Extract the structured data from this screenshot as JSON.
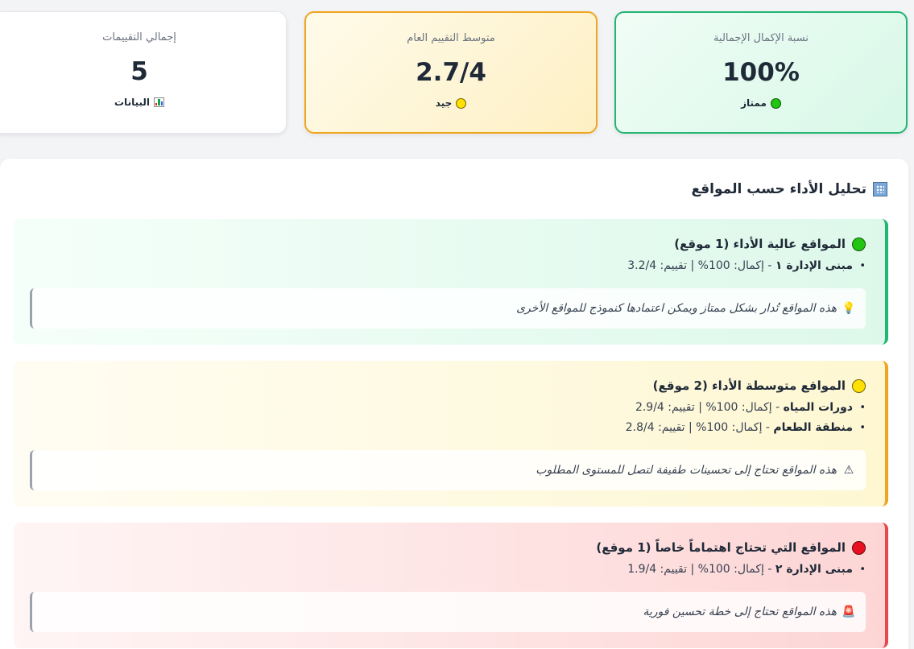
{
  "stats": {
    "completion": {
      "label": "نسبة الإكمال الإجمالية",
      "value": "100%",
      "badge": "ممتاز",
      "badge_icon": "green-circle-icon",
      "accent": "#22b573"
    },
    "average": {
      "label": "متوسط التقييم العام",
      "value": "2.7/4",
      "badge": "جيد",
      "badge_icon": "yellow-circle-icon",
      "accent": "#f0a521"
    },
    "total": {
      "label": "إجمالي التقييمات",
      "value": "5",
      "badge": "البيانات",
      "badge_icon": "bar-chart-icon"
    }
  },
  "analysis": {
    "title": "تحليل الأداء حسب المواقع",
    "title_icon": "building-icon",
    "groups": [
      {
        "title": "المواقع عالية الأداء (1 موقع)",
        "icon": "green-circle-icon",
        "accent": "#22b573",
        "sites": [
          {
            "name": "مبنى الإدارة ١",
            "details": " - إكمال: 100% | تقييم: 3.2/4"
          }
        ],
        "note_icon": "lightbulb-icon",
        "note": "هذه المواقع تُدار بشكل ممتاز ويمكن اعتمادها كنموذج للمواقع الأخرى"
      },
      {
        "title": "المواقع متوسطة الأداء (2 موقع)",
        "icon": "yellow-circle-icon",
        "accent": "#f0a521",
        "sites": [
          {
            "name": "دورات المياه",
            "details": " - إكمال: 100% | تقييم: 2.9/4"
          },
          {
            "name": "منطقة الطعام",
            "details": " - إكمال: 100% | تقييم: 2.8/4"
          }
        ],
        "note_icon": "warning-icon",
        "note": "هذه المواقع تحتاج إلى تحسينات طفيفة لتصل للمستوى المطلوب"
      },
      {
        "title": "المواقع التي تحتاج اهتماماً خاصاً (1 موقع)",
        "icon": "red-circle-icon",
        "accent": "#e5484d",
        "sites": [
          {
            "name": "مبنى الإدارة ٢",
            "details": " - إكمال: 100% | تقييم: 1.9/4"
          }
        ],
        "note_icon": "alarm-light-icon",
        "note": "هذه المواقع تحتاج إلى خطة تحسين فورية"
      }
    ]
  }
}
